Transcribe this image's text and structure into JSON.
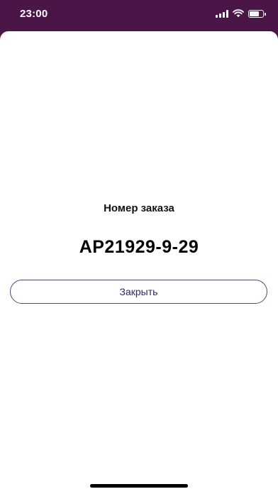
{
  "status_bar": {
    "time": "23:00",
    "signal_icon": "cellular-signal-icon",
    "wifi_icon": "wifi-icon",
    "battery_icon": "battery-icon",
    "battery_level": 0.75
  },
  "modal": {
    "title": "Номер заказа",
    "order_number": "AP21929-9-29",
    "close_label": "Закрыть"
  },
  "colors": {
    "status_bar_bg": "#4b1548",
    "accent": "#2a2a6a",
    "sheet_bg": "#ffffff"
  }
}
